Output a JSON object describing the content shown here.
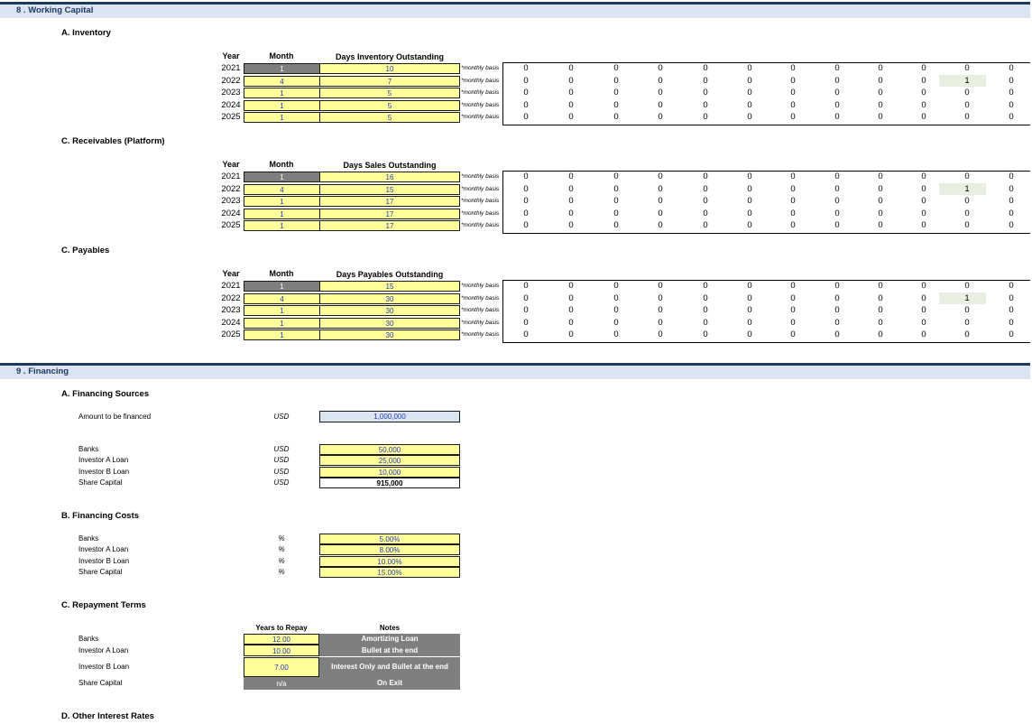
{
  "sections": {
    "wc": {
      "title": "8 . Working Capital"
    },
    "fin": {
      "title": "9 . Financing"
    }
  },
  "col_headers": {
    "year": "Year",
    "month": "Month"
  },
  "monthly_basis": "*monthly basis",
  "blocks": [
    {
      "title": "A.   Inventory",
      "metric": "Days Inventory Outstanding",
      "rows": [
        {
          "year": "2021",
          "month": "1",
          "value": "10"
        },
        {
          "year": "2022",
          "month": "4",
          "value": "7"
        },
        {
          "year": "2023",
          "month": "1",
          "value": "5"
        },
        {
          "year": "2024",
          "month": "1",
          "value": "5"
        },
        {
          "year": "2025",
          "month": "1",
          "value": "5"
        }
      ]
    },
    {
      "title": "C.   Receivables (Platform)",
      "metric": "Days Sales Outstanding",
      "rows": [
        {
          "year": "2021",
          "month": "1",
          "value": "16"
        },
        {
          "year": "2022",
          "month": "4",
          "value": "15"
        },
        {
          "year": "2023",
          "month": "1",
          "value": "17"
        },
        {
          "year": "2024",
          "month": "1",
          "value": "17"
        },
        {
          "year": "2025",
          "month": "1",
          "value": "17"
        }
      ]
    },
    {
      "title": "C.   Payables",
      "metric": "Days Payables Outstanding",
      "rows": [
        {
          "year": "2021",
          "month": "1",
          "value": "15"
        },
        {
          "year": "2022",
          "month": "4",
          "value": "30"
        },
        {
          "year": "2023",
          "month": "1",
          "value": "30"
        },
        {
          "year": "2024",
          "month": "1",
          "value": "30"
        },
        {
          "year": "2025",
          "month": "1",
          "value": "30"
        }
      ]
    }
  ],
  "grid_rows": [
    [
      "0",
      "0",
      "0",
      "0",
      "0",
      "0",
      "0",
      "0",
      "0",
      "0",
      "0",
      "0"
    ],
    [
      "0",
      "0",
      "0",
      "0",
      "0",
      "0",
      "0",
      "0",
      "0",
      "0",
      "1",
      "0"
    ],
    [
      "0",
      "0",
      "0",
      "0",
      "0",
      "0",
      "0",
      "0",
      "0",
      "0",
      "0",
      "0"
    ],
    [
      "0",
      "0",
      "0",
      "0",
      "0",
      "0",
      "0",
      "0",
      "0",
      "0",
      "0",
      "0"
    ],
    [
      "0",
      "0",
      "0",
      "0",
      "0",
      "0",
      "0",
      "0",
      "0",
      "0",
      "0",
      "0"
    ]
  ],
  "financing": {
    "sources_title": "A.   Financing Sources",
    "amount_label": "Amount to be financed",
    "amount_unit": "USD",
    "amount_value": "1,000,000",
    "sources": [
      {
        "label": "Banks",
        "unit": "USD",
        "value": "50,000"
      },
      {
        "label": "Investor A Loan",
        "unit": "USD",
        "value": "25,000"
      },
      {
        "label": "Investor B Loan",
        "unit": "USD",
        "value": "10,000"
      },
      {
        "label": "Share Capital",
        "unit": "USD",
        "value": "915,000"
      }
    ],
    "costs_title": "B.   Financing Costs",
    "costs": [
      {
        "label": "Banks",
        "unit": "%",
        "value": "5.00%"
      },
      {
        "label": "Investor A Loan",
        "unit": "%",
        "value": "8.00%"
      },
      {
        "label": "Investor B Loan",
        "unit": "%",
        "value": "10.00%"
      },
      {
        "label": "Share Capital",
        "unit": "%",
        "value": "15.00%"
      }
    ],
    "repay_title": "C.   Repayment Terms",
    "repay_headers": {
      "years": "Years to Repay",
      "notes": "Notes"
    },
    "repay": [
      {
        "label": "Banks",
        "years": "12.00",
        "note": "Amortizing Loan"
      },
      {
        "label": "Investor A Loan",
        "years": "10.00",
        "note": "Bullet at the end"
      },
      {
        "label": "Investor B Loan",
        "years": "7.00",
        "note": "Interest Only and Bullet at the end"
      },
      {
        "label": "Share Capital",
        "years": "n/a",
        "note": "On Exit"
      }
    ],
    "other_title": "D.   Other Interest Rates"
  },
  "colors": {
    "input_yellow": "#ffff9c",
    "header_gray": "#7f7f7f",
    "section_blue": "#dbe5f1",
    "value_blue": "#1f3bb3"
  }
}
